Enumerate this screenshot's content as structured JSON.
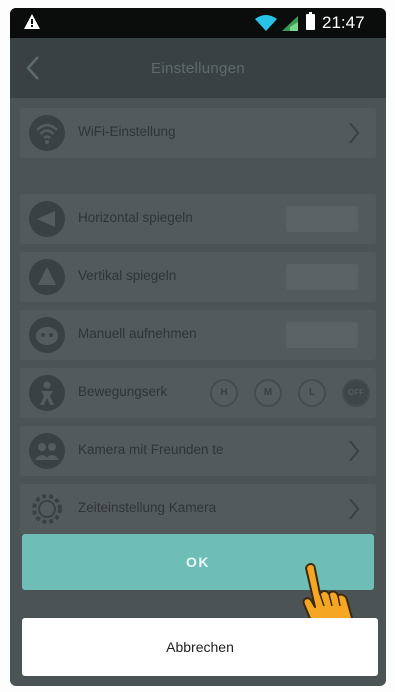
{
  "status_bar": {
    "time": "21:47",
    "icons": [
      "warning-icon",
      "wifi-icon",
      "signal-icon",
      "battery-icon"
    ]
  },
  "header": {
    "title": "Einstellungen",
    "back_icon": "chevron-left-icon"
  },
  "settings": [
    {
      "label": "WiFi-Einstellung",
      "icon": "wifi-icon",
      "control": "chevron"
    },
    {
      "label": "Horizontal spiegeln",
      "icon": "mirror-horizontal-icon",
      "control": "switch"
    },
    {
      "label": "Vertikal spiegeln",
      "icon": "mirror-vertical-icon",
      "control": "switch"
    },
    {
      "label": "Manuell aufnehmen",
      "icon": "record-icon",
      "control": "switch"
    },
    {
      "label": "Bewegungserk",
      "icon": "motion-icon",
      "control": "modes",
      "modes": [
        "H",
        "M",
        "L",
        "OFF"
      ]
    },
    {
      "label": "Kamera mit Freunden te",
      "icon": "share-icon",
      "control": "chevron"
    },
    {
      "label": "Zeiteinstellung Kamera",
      "icon": "time-settings-icon",
      "control": "chevron"
    }
  ],
  "buttons": {
    "ok_label": "OK",
    "cancel_label": "Abbrechen"
  },
  "colors": {
    "accent": "#6fbdb7",
    "overlay": "#4c5354",
    "hand": "#f5a623"
  }
}
